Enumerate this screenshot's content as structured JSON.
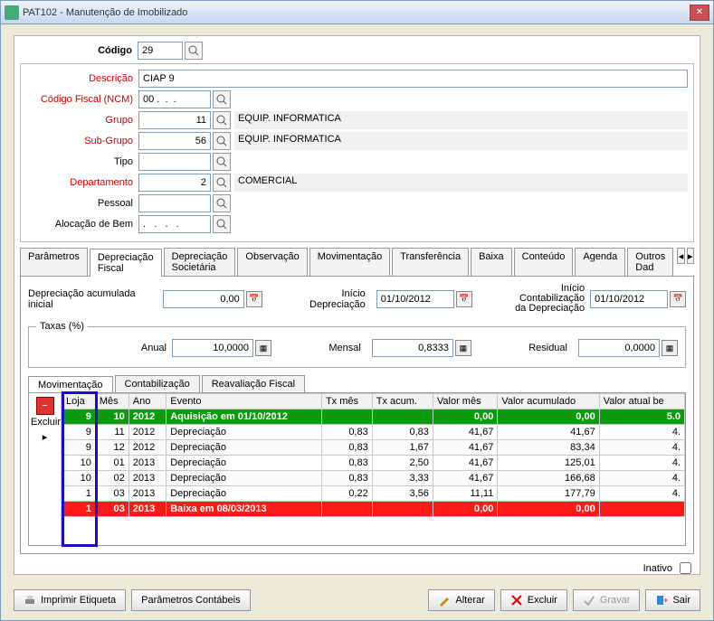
{
  "window": {
    "title": "PAT102 - Manutenção de Imobilizado"
  },
  "header": {
    "codigo_label": "Código",
    "codigo_value": "29",
    "descricao_label": "Descrição",
    "descricao_value": "CIAP 9",
    "ncm_label": "Código Fiscal (NCM)",
    "ncm_value": "00 .  .  .",
    "grupo_label": "Grupo",
    "grupo_value": "11",
    "grupo_disp": "EQUIP. INFORMATICA",
    "subgrupo_label": "Sub-Grupo",
    "subgrupo_value": "56",
    "subgrupo_disp": "EQUIP. INFORMATICA",
    "tipo_label": "Tipo",
    "tipo_value": "",
    "depto_label": "Departamento",
    "depto_value": "2",
    "depto_disp": "COMERCIAL",
    "pessoal_label": "Pessoal",
    "pessoal_value": "",
    "aloc_label": "Alocação de Bem",
    "aloc_value": ".   .   .   ."
  },
  "tabs": {
    "items": [
      "Parâmetros",
      "Depreciação Fiscal",
      "Depreciação Societária",
      "Observação",
      "Movimentação",
      "Transferência",
      "Baixa",
      "Conteúdo",
      "Agenda",
      "Outros Dad"
    ],
    "active": 1
  },
  "dep": {
    "acum_label": "Depreciação acumulada inicial",
    "acum_value": "0,00",
    "inicio_label": "Início Depreciação",
    "inicio_value": "01/10/2012",
    "contab_label1": "Início Contabilização",
    "contab_label2": "da Depreciação",
    "contab_value": "01/10/2012",
    "taxas_legend": "Taxas (%)",
    "anual_label": "Anual",
    "anual_value": "10,0000",
    "mensal_label": "Mensal",
    "mensal_value": "0,8333",
    "residual_label": "Residual",
    "residual_value": "0,0000"
  },
  "subtabs": {
    "items": [
      "Movimentação",
      "Contabilização",
      "Reavaliação Fiscal"
    ],
    "active": 0
  },
  "grid": {
    "excluir_label": "Excluir",
    "cols": [
      "Loja",
      "Mês",
      "Ano",
      "Evento",
      "Tx mês",
      "Tx acum.",
      "Valor mês",
      "Valor acumulado",
      "Valor atual be"
    ],
    "rows": [
      {
        "style": "green",
        "loja": "9",
        "mes": "10",
        "ano": "2012",
        "evento": "Aquisição em 01/10/2012",
        "txm": "",
        "txa": "",
        "vm": "0,00",
        "va": "0,00",
        "vat": "5.0"
      },
      {
        "style": "",
        "loja": "9",
        "mes": "11",
        "ano": "2012",
        "evento": "Depreciação",
        "txm": "0,83",
        "txa": "0,83",
        "vm": "41,67",
        "va": "41,67",
        "vat": "4."
      },
      {
        "style": "alt",
        "loja": "9",
        "mes": "12",
        "ano": "2012",
        "evento": "Depreciação",
        "txm": "0,83",
        "txa": "1,67",
        "vm": "41,67",
        "va": "83,34",
        "vat": "4."
      },
      {
        "style": "",
        "loja": "10",
        "mes": "01",
        "ano": "2013",
        "evento": "Depreciação",
        "txm": "0,83",
        "txa": "2,50",
        "vm": "41,67",
        "va": "125,01",
        "vat": "4."
      },
      {
        "style": "alt",
        "loja": "10",
        "mes": "02",
        "ano": "2013",
        "evento": "Depreciação",
        "txm": "0,83",
        "txa": "3,33",
        "vm": "41,67",
        "va": "166,68",
        "vat": "4."
      },
      {
        "style": "",
        "loja": "1",
        "mes": "03",
        "ano": "2013",
        "evento": "Depreciação",
        "txm": "0,22",
        "txa": "3,56",
        "vm": "11,11",
        "va": "177,79",
        "vat": "4."
      },
      {
        "style": "red",
        "loja": "1",
        "mes": "03",
        "ano": "2013",
        "evento": "Baixa em 08/03/2013",
        "txm": "",
        "txa": "",
        "vm": "0,00",
        "va": "0,00",
        "vat": ""
      }
    ]
  },
  "inativo_label": "Inativo",
  "buttons": {
    "imprimir": "Imprimir Etiqueta",
    "param": "Parâmetros Contábeis",
    "alterar": "Alterar",
    "excluir": "Excluir",
    "gravar": "Gravar",
    "sair": "Sair"
  }
}
